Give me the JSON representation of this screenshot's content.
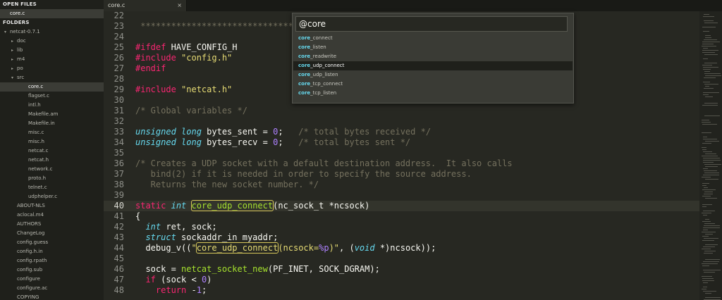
{
  "sidebar": {
    "open_files_header": "OPEN FILES",
    "open_files": [
      "core.c"
    ],
    "folders_header": "FOLDERS",
    "tree": [
      {
        "label": "netcat-0.7.1",
        "depth": 0,
        "arrow": "▾"
      },
      {
        "label": "doc",
        "depth": 1,
        "arrow": "▸"
      },
      {
        "label": "lib",
        "depth": 1,
        "arrow": "▸"
      },
      {
        "label": "m4",
        "depth": 1,
        "arrow": "▸"
      },
      {
        "label": "po",
        "depth": 1,
        "arrow": "▸"
      },
      {
        "label": "src",
        "depth": 1,
        "arrow": "▾"
      },
      {
        "label": "core.c",
        "depth": 2,
        "arrow": "",
        "selected": true
      },
      {
        "label": "flagset.c",
        "depth": 2,
        "arrow": ""
      },
      {
        "label": "intl.h",
        "depth": 2,
        "arrow": ""
      },
      {
        "label": "Makefile.am",
        "depth": 2,
        "arrow": ""
      },
      {
        "label": "Makefile.in",
        "depth": 2,
        "arrow": ""
      },
      {
        "label": "misc.c",
        "depth": 2,
        "arrow": ""
      },
      {
        "label": "misc.h",
        "depth": 2,
        "arrow": ""
      },
      {
        "label": "netcat.c",
        "depth": 2,
        "arrow": ""
      },
      {
        "label": "netcat.h",
        "depth": 2,
        "arrow": ""
      },
      {
        "label": "network.c",
        "depth": 2,
        "arrow": ""
      },
      {
        "label": "proto.h",
        "depth": 2,
        "arrow": ""
      },
      {
        "label": "telnet.c",
        "depth": 2,
        "arrow": ""
      },
      {
        "label": "udphelper.c",
        "depth": 2,
        "arrow": ""
      },
      {
        "label": "ABOUT-NLS",
        "depth": 1,
        "arrow": ""
      },
      {
        "label": "aclocal.m4",
        "depth": 1,
        "arrow": ""
      },
      {
        "label": "AUTHORS",
        "depth": 1,
        "arrow": ""
      },
      {
        "label": "ChangeLog",
        "depth": 1,
        "arrow": ""
      },
      {
        "label": "config.guess",
        "depth": 1,
        "arrow": ""
      },
      {
        "label": "config.h.in",
        "depth": 1,
        "arrow": ""
      },
      {
        "label": "config.rpath",
        "depth": 1,
        "arrow": ""
      },
      {
        "label": "config.sub",
        "depth": 1,
        "arrow": ""
      },
      {
        "label": "configure",
        "depth": 1,
        "arrow": ""
      },
      {
        "label": "configure.ac",
        "depth": 1,
        "arrow": ""
      },
      {
        "label": "COPYING",
        "depth": 1,
        "arrow": ""
      }
    ]
  },
  "tab": {
    "label": "core.c",
    "close": "×"
  },
  "editor": {
    "current_line": 40,
    "lines": [
      {
        "n": 22,
        "tokens": [
          {
            "t": "",
            "c": ""
          }
        ]
      },
      {
        "n": 23,
        "tokens": [
          {
            "t": " ******************************************",
            "c": "cm"
          }
        ]
      },
      {
        "n": 24,
        "tokens": [
          {
            "t": "",
            "c": ""
          }
        ]
      },
      {
        "n": 25,
        "tokens": [
          {
            "t": "#ifdef",
            "c": "kw"
          },
          {
            "t": " HAVE_CONFIG_H",
            "c": ""
          }
        ]
      },
      {
        "n": 26,
        "tokens": [
          {
            "t": "#include",
            "c": "kw"
          },
          {
            "t": " ",
            "c": ""
          },
          {
            "t": "\"config.h\"",
            "c": "st"
          }
        ]
      },
      {
        "n": 27,
        "tokens": [
          {
            "t": "#endif",
            "c": "kw"
          }
        ]
      },
      {
        "n": 28,
        "tokens": [
          {
            "t": "",
            "c": ""
          }
        ]
      },
      {
        "n": 29,
        "tokens": [
          {
            "t": "#include",
            "c": "kw"
          },
          {
            "t": " ",
            "c": ""
          },
          {
            "t": "\"netcat.h\"",
            "c": "st"
          }
        ]
      },
      {
        "n": 30,
        "tokens": [
          {
            "t": "",
            "c": ""
          }
        ]
      },
      {
        "n": 31,
        "tokens": [
          {
            "t": "/* Global variables */",
            "c": "cm"
          }
        ]
      },
      {
        "n": 32,
        "tokens": [
          {
            "t": "",
            "c": ""
          }
        ]
      },
      {
        "n": 33,
        "tokens": [
          {
            "t": "unsigned long",
            "c": "ty"
          },
          {
            "t": " bytes_sent = ",
            "c": ""
          },
          {
            "t": "0",
            "c": "num"
          },
          {
            "t": ";   ",
            "c": ""
          },
          {
            "t": "/* total bytes received */",
            "c": "cm"
          }
        ]
      },
      {
        "n": 34,
        "tokens": [
          {
            "t": "unsigned long",
            "c": "ty"
          },
          {
            "t": " bytes_recv = ",
            "c": ""
          },
          {
            "t": "0",
            "c": "num"
          },
          {
            "t": ";   ",
            "c": ""
          },
          {
            "t": "/* total bytes sent */",
            "c": "cm"
          }
        ]
      },
      {
        "n": 35,
        "tokens": [
          {
            "t": "",
            "c": ""
          }
        ]
      },
      {
        "n": 36,
        "tokens": [
          {
            "t": "/* Creates a UDP socket with a default destination address.  It also calls",
            "c": "cm"
          }
        ]
      },
      {
        "n": 37,
        "tokens": [
          {
            "t": "   bind(2) if it is needed in order to specify the source address.",
            "c": "cm"
          }
        ]
      },
      {
        "n": 38,
        "tokens": [
          {
            "t": "   Returns the new socket number. */",
            "c": "cm"
          }
        ]
      },
      {
        "n": 39,
        "tokens": [
          {
            "t": "",
            "c": ""
          }
        ]
      },
      {
        "n": 40,
        "tokens": [
          {
            "t": "static",
            "c": "kw"
          },
          {
            "t": " ",
            "c": ""
          },
          {
            "t": "int",
            "c": "ty"
          },
          {
            "t": " ",
            "c": ""
          },
          {
            "t": "core_udp_connect",
            "c": "fn hl"
          },
          {
            "t": "(nc_sock_t *ncsock)",
            "c": ""
          }
        ]
      },
      {
        "n": 41,
        "tokens": [
          {
            "t": "{",
            "c": ""
          }
        ]
      },
      {
        "n": 42,
        "tokens": [
          {
            "t": "  ",
            "c": ""
          },
          {
            "t": "int",
            "c": "ty"
          },
          {
            "t": " ret, sock;",
            "c": ""
          }
        ]
      },
      {
        "n": 43,
        "tokens": [
          {
            "t": "  ",
            "c": ""
          },
          {
            "t": "struct",
            "c": "ty"
          },
          {
            "t": " sockaddr_in myaddr;",
            "c": ""
          }
        ]
      },
      {
        "n": 44,
        "tokens": [
          {
            "t": "  debug_v((",
            "c": ""
          },
          {
            "t": "\"",
            "c": "st"
          },
          {
            "t": "core_udp_connect",
            "c": "st hl"
          },
          {
            "t": "(ncsock=",
            "c": "st"
          },
          {
            "t": "%p",
            "c": "num"
          },
          {
            "t": ")\"",
            "c": "st"
          },
          {
            "t": ", (",
            "c": ""
          },
          {
            "t": "void",
            "c": "ty"
          },
          {
            "t": " *)ncsock));",
            "c": ""
          }
        ]
      },
      {
        "n": 45,
        "tokens": [
          {
            "t": "",
            "c": ""
          }
        ]
      },
      {
        "n": 46,
        "tokens": [
          {
            "t": "  sock = ",
            "c": ""
          },
          {
            "t": "netcat_socket_new",
            "c": "fn"
          },
          {
            "t": "(PF_INET, SOCK_DGRAM);",
            "c": ""
          }
        ]
      },
      {
        "n": 47,
        "tokens": [
          {
            "t": "  ",
            "c": ""
          },
          {
            "t": "if",
            "c": "kw"
          },
          {
            "t": " (sock < ",
            "c": ""
          },
          {
            "t": "0",
            "c": "num"
          },
          {
            "t": ")",
            "c": ""
          }
        ]
      },
      {
        "n": 48,
        "tokens": [
          {
            "t": "    ",
            "c": ""
          },
          {
            "t": "return",
            "c": "kw"
          },
          {
            "t": " -",
            "c": ""
          },
          {
            "t": "1",
            "c": "num"
          },
          {
            "t": ";",
            "c": ""
          }
        ]
      }
    ]
  },
  "palette": {
    "query": "@core",
    "match": "core",
    "selected_index": 3,
    "items": [
      "core_connect",
      "core_listen",
      "core_readwrite",
      "core_udp_connect",
      "core_udp_listen",
      "core_tcp_connect",
      "core_tcp_listen"
    ]
  },
  "colors": {
    "background": "#272822",
    "keyword": "#f92672",
    "type": "#66d9ef",
    "string": "#e6db74",
    "comment": "#75715e",
    "function": "#a6e22e",
    "number": "#ae81ff"
  }
}
